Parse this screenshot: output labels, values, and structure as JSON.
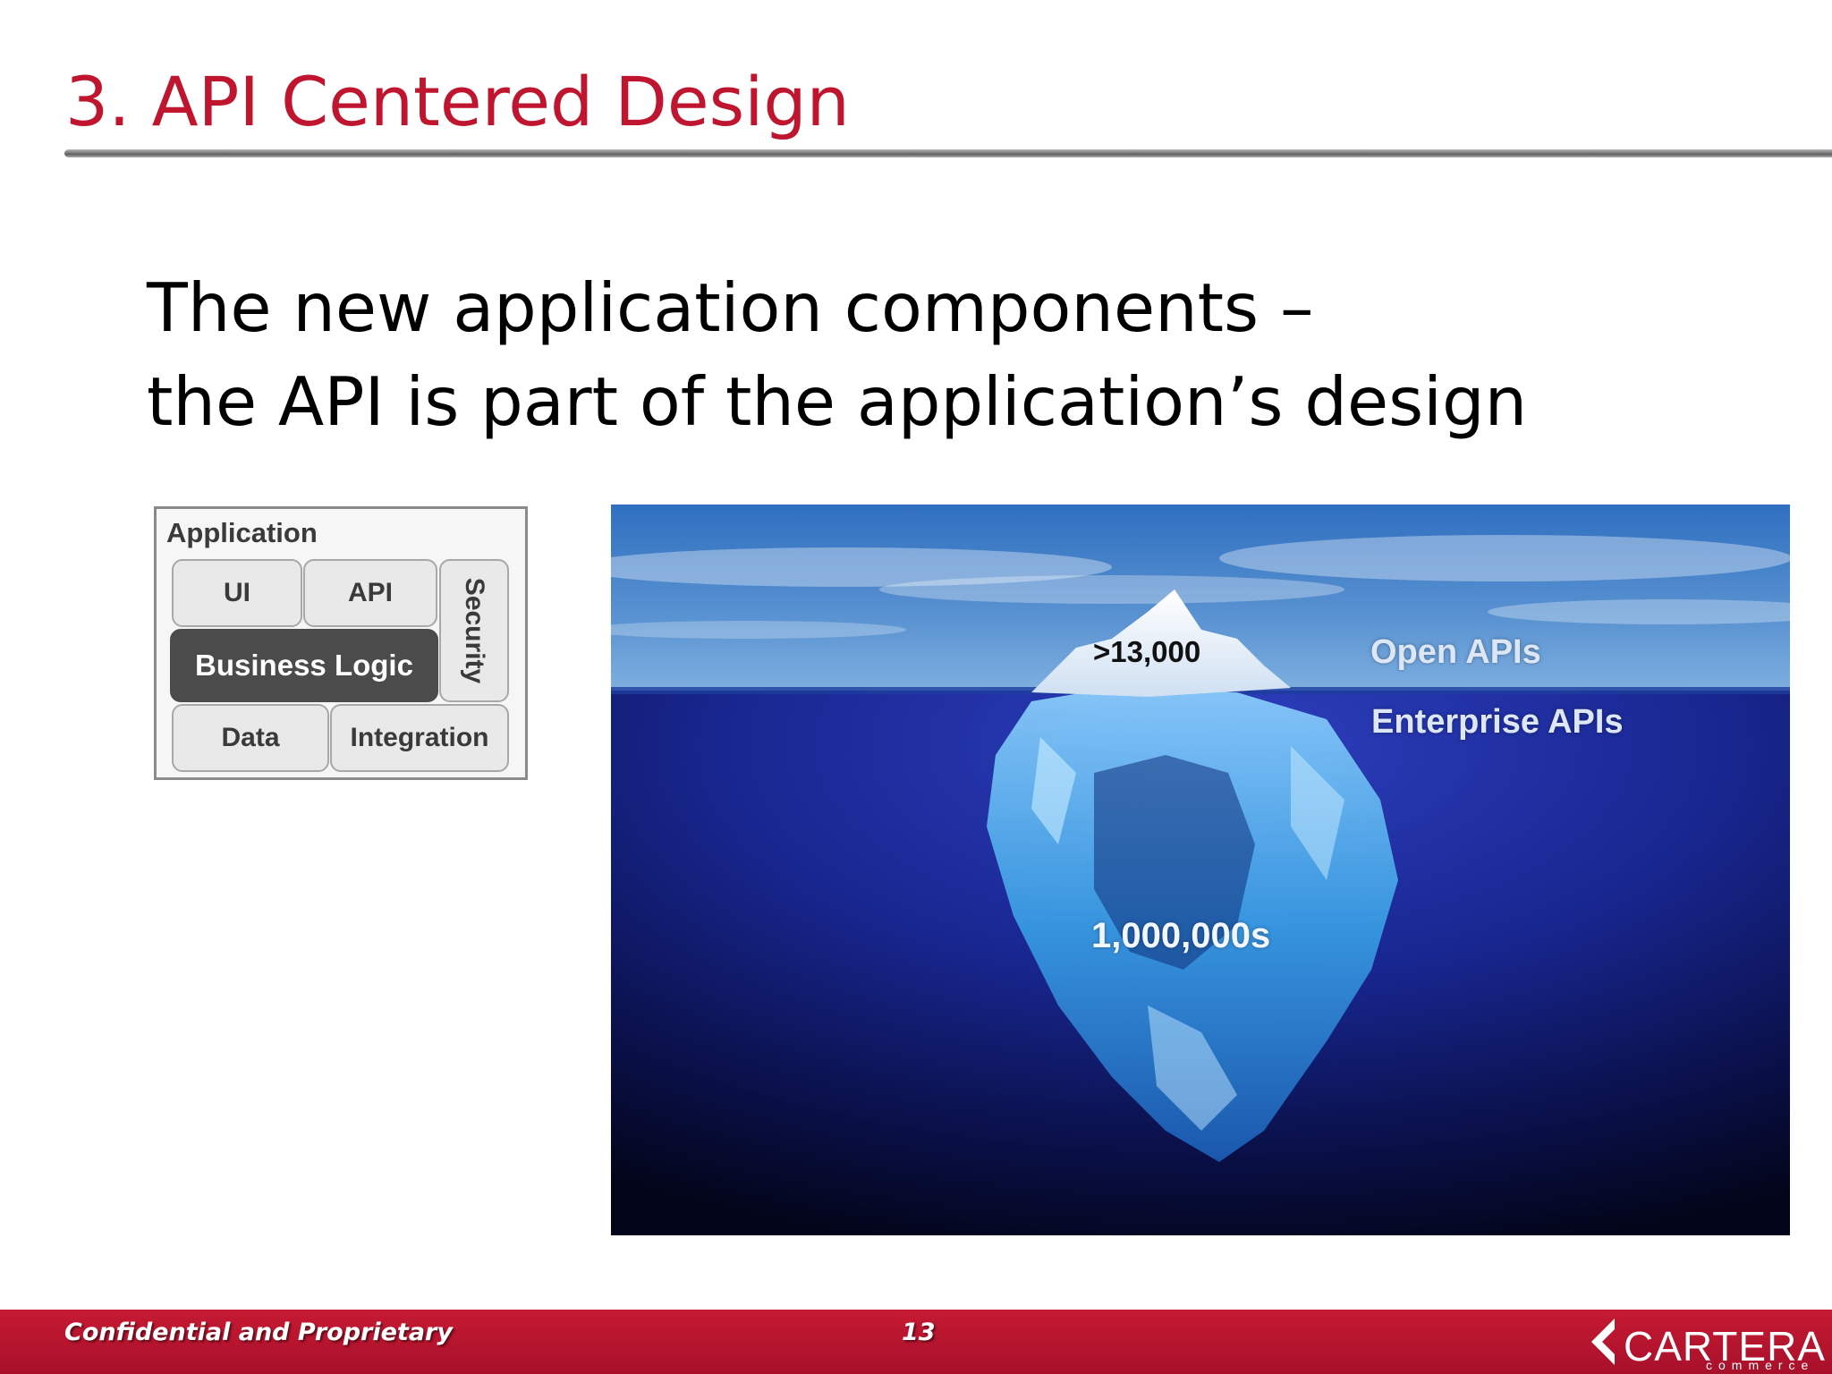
{
  "slide": {
    "title": "3. API Centered Design",
    "headline_line1": "The new application components –",
    "headline_line2": "the API is part of the application’s design"
  },
  "app_diagram": {
    "title": "Application",
    "components": {
      "ui": "UI",
      "api": "API",
      "security": "Security",
      "business_logic": "Business Logic",
      "data": "Data",
      "integration": "Integration"
    }
  },
  "iceberg": {
    "tip_count": ">13,000",
    "open_label": "Open APIs",
    "enterprise_label": "Enterprise APIs",
    "submerged_count": "1,000,000s"
  },
  "footer": {
    "confidential": "Confidential and Proprietary",
    "page_number": "13",
    "logo_text": "CARTERA",
    "logo_subtext": "commerce"
  },
  "colors": {
    "title_red": "#c0152f",
    "footer_red": "#b3132d",
    "diagram_dark": "#4b4b4b"
  }
}
